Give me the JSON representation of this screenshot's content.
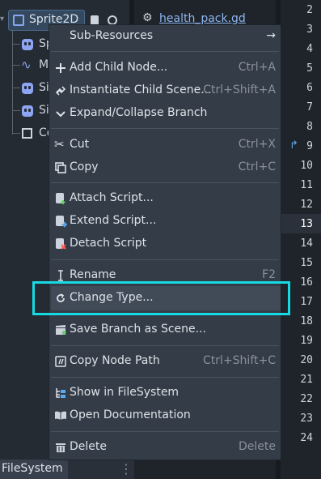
{
  "scene_tree": {
    "selected_node": "Sprite2D",
    "children": [
      {
        "label": "Spr",
        "icon": "face-icon"
      },
      {
        "label": "M",
        "icon": "animation-icon"
      },
      {
        "label": "Sic",
        "icon": "face-icon"
      },
      {
        "label": "Sic",
        "icon": "face-icon"
      },
      {
        "label": "Co",
        "icon": "box-icon"
      }
    ]
  },
  "script_tab": {
    "label": "health_pack.gd"
  },
  "line_numbers": [
    "2",
    "3",
    "4",
    "5",
    "6",
    "7",
    "8",
    "9",
    "10",
    "11",
    "12",
    "13",
    "14",
    "15",
    "16",
    "17",
    "18",
    "19",
    "20",
    "21",
    "22",
    "23",
    "24"
  ],
  "current_line": "13",
  "bottom_dock": {
    "tab": "FileSystem"
  },
  "context_menu": {
    "items": [
      {
        "label": "Sub-Resources",
        "shortcut": "",
        "icon": "none",
        "submenu": true
      },
      {
        "label": "Add Child Node...",
        "shortcut": "Ctrl+A",
        "icon": "plus-icon"
      },
      {
        "label": "Instantiate Child Scene...",
        "shortcut": "Ctrl+Shift+A",
        "icon": "link-icon"
      },
      {
        "label": "Expand/Collapse Branch",
        "shortcut": "",
        "icon": "chevron-down-icon"
      },
      {
        "label": "Cut",
        "shortcut": "Ctrl+X",
        "icon": "scissors-icon"
      },
      {
        "label": "Copy",
        "shortcut": "Ctrl+C",
        "icon": "copy-icon"
      },
      {
        "label": "Attach Script...",
        "shortcut": "",
        "icon": "script-add-icon"
      },
      {
        "label": "Extend Script...",
        "shortcut": "",
        "icon": "script-extend-icon"
      },
      {
        "label": "Detach Script",
        "shortcut": "",
        "icon": "script-remove-icon"
      },
      {
        "label": "Rename",
        "shortcut": "F2",
        "icon": "rename-icon"
      },
      {
        "label": "Change Type...",
        "shortcut": "",
        "icon": "rotate-icon"
      },
      {
        "label": "Save Branch as Scene...",
        "shortcut": "",
        "icon": "clapper-icon"
      },
      {
        "label": "Copy Node Path",
        "shortcut": "Ctrl+Shift+C",
        "icon": "path-icon"
      },
      {
        "label": "Show in FileSystem",
        "shortcut": "",
        "icon": "filesystem-icon"
      },
      {
        "label": "Open Documentation",
        "shortcut": "",
        "icon": "doc-icon"
      },
      {
        "label": "Delete",
        "shortcut": "Delete",
        "icon": "trash-icon"
      }
    ]
  },
  "colors": {
    "accent": "#8da5f3",
    "highlight_box": "#16d9e3",
    "menu_bg": "#343c47"
  }
}
